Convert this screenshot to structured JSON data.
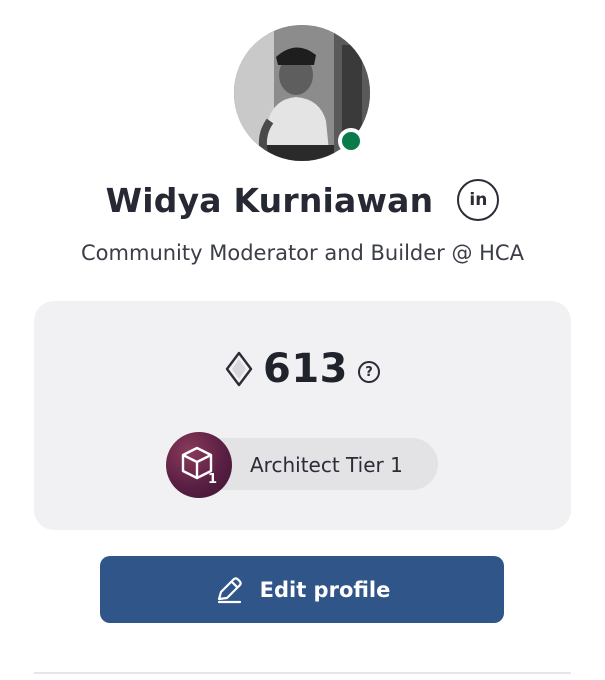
{
  "profile": {
    "name": "Widya Kurniawan",
    "linkedin_label": "in",
    "tagline": "Community Moderator and Builder @ HCA",
    "online": true
  },
  "stats": {
    "points": "613",
    "help_label": "?"
  },
  "tier": {
    "label": "Architect Tier 1",
    "badge_number": "1"
  },
  "actions": {
    "edit_profile_label": "Edit profile"
  },
  "colors": {
    "primary_button": "#2f5589",
    "online_indicator": "#0a7a4b",
    "card_background": "#f1f1f3",
    "tier_badge": "#5a1f44"
  },
  "icons": {
    "linkedin": "linkedin-icon",
    "points": "diamond-icon",
    "help": "question-circle-icon",
    "tier": "cube-icon",
    "edit": "pencil-icon"
  }
}
